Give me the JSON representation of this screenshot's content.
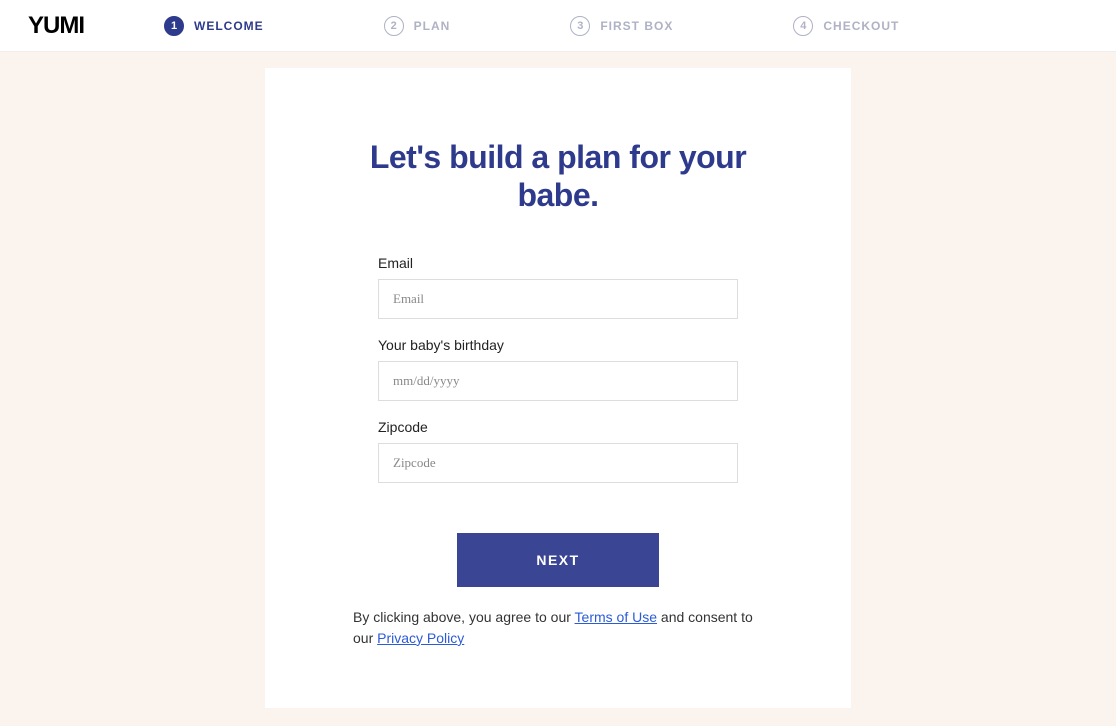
{
  "logo": "YUMI",
  "steps": [
    {
      "num": "1",
      "label": "WELCOME",
      "active": true
    },
    {
      "num": "2",
      "label": "PLAN",
      "active": false
    },
    {
      "num": "3",
      "label": "FIRST BOX",
      "active": false
    },
    {
      "num": "4",
      "label": "CHECKOUT",
      "active": false
    }
  ],
  "heading": "Let's build a plan for your babe.",
  "form": {
    "email_label": "Email",
    "email_placeholder": "Email",
    "birthday_label": "Your baby's birthday",
    "birthday_placeholder": "mm/dd/yyyy",
    "zipcode_label": "Zipcode",
    "zipcode_placeholder": "Zipcode"
  },
  "next_button": "NEXT",
  "disclaimer": {
    "part1": "By clicking above, you agree to our ",
    "terms": "Terms of Use",
    "part2": " and consent to our ",
    "privacy": "Privacy Policy"
  }
}
